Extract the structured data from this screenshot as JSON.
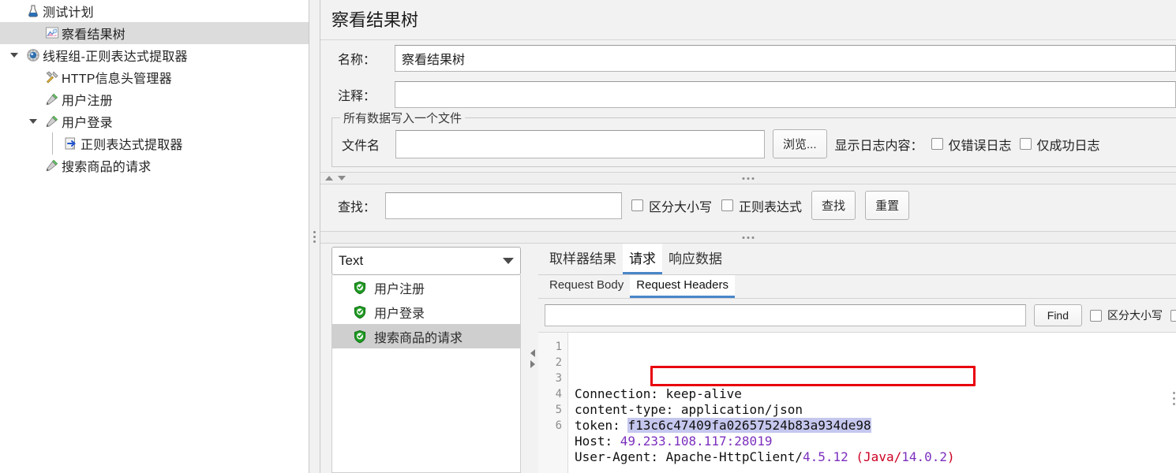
{
  "tree": {
    "items": [
      {
        "label": "测试计划",
        "icon": "test-plan-icon",
        "indent": 1,
        "twisty": "none",
        "selected": false
      },
      {
        "label": "察看结果树",
        "icon": "view-results-tree-icon",
        "indent": 2,
        "twisty": "none",
        "selected": true
      },
      {
        "label": "线程组-正则表达式提取器",
        "icon": "thread-group-icon",
        "indent": 1,
        "twisty": "expanded",
        "selected": false
      },
      {
        "label": "HTTP信息头管理器",
        "icon": "header-manager-icon",
        "indent": 2,
        "twisty": "none",
        "selected": false
      },
      {
        "label": "用户注册",
        "icon": "http-sampler-icon",
        "indent": 2,
        "twisty": "none",
        "selected": false
      },
      {
        "label": "用户登录",
        "icon": "http-sampler-icon",
        "indent": 2,
        "twisty": "expanded",
        "selected": false
      },
      {
        "label": "正则表达式提取器",
        "icon": "regex-extractor-icon",
        "indent": 3,
        "twisty": "none",
        "selected": false
      },
      {
        "label": "搜索商品的请求",
        "icon": "http-sampler-icon",
        "indent": 2,
        "twisty": "none",
        "selected": false
      }
    ]
  },
  "panel": {
    "title": "察看结果树",
    "name_label": "名称：",
    "name_value": "察看结果树",
    "comment_label": "注释：",
    "comment_value": "",
    "comment_placeholder": ""
  },
  "filegroup": {
    "legend": "所有数据写入一个文件",
    "filename_label": "文件名",
    "filename_value": "",
    "filename_placeholder": "",
    "browse_button": "浏览...",
    "log_display_label": "显示日志内容：",
    "errors_only_label": "仅错误日志",
    "errors_only_checked": false,
    "success_only_label": "仅成功日志",
    "success_only_checked": false
  },
  "searchbar": {
    "label": "查找：",
    "value": "",
    "placeholder": "",
    "case_sensitive_label": "区分大小写",
    "case_sensitive_checked": false,
    "regex_label": "正则表达式",
    "regex_checked": false,
    "search_button": "查找",
    "reset_button": "重置"
  },
  "results": {
    "render_selected": "Text",
    "render_options": [
      "Text"
    ],
    "samplers": [
      {
        "label": "用户注册",
        "status": "success",
        "selected": false
      },
      {
        "label": "用户登录",
        "status": "success",
        "selected": false
      },
      {
        "label": "搜索商品的请求",
        "status": "success",
        "selected": true
      }
    ]
  },
  "tabs": {
    "main": [
      {
        "label": "取样器结果",
        "active": false
      },
      {
        "label": "请求",
        "active": true
      },
      {
        "label": "响应数据",
        "active": false
      }
    ],
    "sub": [
      {
        "label": "Request Body",
        "active": false
      },
      {
        "label": "Request Headers",
        "active": true
      }
    ],
    "accent_color": "#4a86c8"
  },
  "findbar": {
    "value": "",
    "placeholder": "",
    "find_button": "Find",
    "case_sensitive_label": "区分大小写",
    "case_sensitive_checked": false,
    "extra_checkbox_checked": false
  },
  "code": {
    "line_numbers": [
      "1",
      "2",
      "3",
      "4",
      "5",
      "6"
    ],
    "highlight_color": "#e8000d",
    "selection_color": "#c5c7ee",
    "lines": [
      {
        "n": "1",
        "segments": [
          {
            "text": "Connection: keep-alive",
            "style": "k"
          }
        ]
      },
      {
        "n": "2",
        "segments": [
          {
            "text": "content-type: application/json",
            "style": "k"
          }
        ]
      },
      {
        "n": "3",
        "segments": [
          {
            "text": "token: ",
            "style": "k"
          },
          {
            "text": "f13c6c47409fa02657524b83a934de98",
            "style": "sel"
          }
        ]
      },
      {
        "n": "4",
        "segments": [
          {
            "text": "Host: ",
            "style": "k"
          },
          {
            "text": "49.233.108.117:28019",
            "style": "v-purple"
          }
        ]
      },
      {
        "n": "5",
        "segments": [
          {
            "text": "User-Agent: Apache-HttpClient/",
            "style": "k"
          },
          {
            "text": "4.5.12",
            "style": "v-purple"
          },
          {
            "text": " (",
            "style": "v-red"
          },
          {
            "text": "Java/",
            "style": "v-red"
          },
          {
            "text": "14.0.2",
            "style": "v-purple"
          },
          {
            "text": ")",
            "style": "v-red"
          }
        ]
      },
      {
        "n": "6",
        "segments": [
          {
            "text": "",
            "style": "k"
          }
        ]
      }
    ]
  }
}
